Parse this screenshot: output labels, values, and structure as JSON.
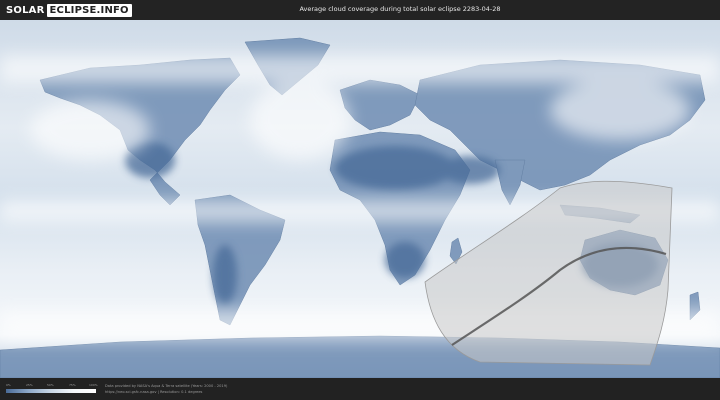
{
  "header": {
    "logo_part1": "SOLAR",
    "logo_part2": "ECLIPSE.INFO",
    "title": "Average cloud coverage during total solar eclipse 2283-04-28"
  },
  "map": {
    "description_type": "world-cloud-coverage-map",
    "ocean_color": "#dde6ef",
    "land_color": "#5d7ea7",
    "cloud_color": "#ffffff",
    "eclipse_zone_color": "#c8c8c8",
    "eclipse_path_color": "#555555"
  },
  "legend": {
    "ticks": [
      "0%",
      "25%",
      "50%",
      "75%",
      "100%"
    ]
  },
  "footer": {
    "credit_line1": "Data provided by NASA's Aqua & Terra satellite (Years: 2000 - 2019)",
    "credit_line2": "https://neo.sci.gsfc.nasa.gov | Resolution: 0.1 degrees"
  }
}
